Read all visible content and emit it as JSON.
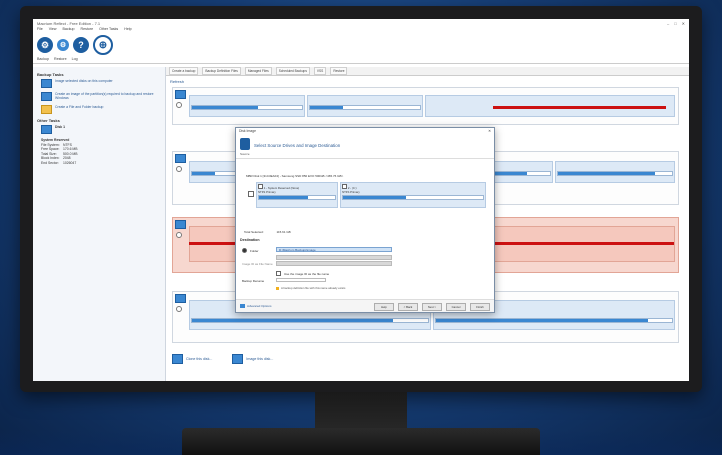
{
  "window": {
    "title": "Macrium Reflect - Free Edition - 7.1",
    "menu": [
      "File",
      "View",
      "Backup",
      "Restore",
      "Other Tasks",
      "Help"
    ],
    "ribbon_tabs": [
      "Backup",
      "Restore",
      "Log"
    ]
  },
  "left_panel": {
    "section_backup": "Backup Tasks",
    "tasks": [
      "Image selected disks on this computer",
      "Create an image of the partition(s) required to backup and restore Windows",
      "Create a File and Folder backup"
    ],
    "section_other": "Other Tasks",
    "section_disk": "Disk 1",
    "props_title": "System Reserved",
    "props": [
      {
        "k": "File System:",
        "v": "NTFS"
      },
      {
        "k": "Free Space:",
        "v": "170.6 MB"
      },
      {
        "k": "Total Size:",
        "v": "500.0 MB"
      },
      {
        "k": "Block Index:",
        "v": "2048"
      },
      {
        "k": "End Sector:",
        "v": "1026047"
      }
    ]
  },
  "content": {
    "tabs": [
      "Create a backup",
      "Backup Definition Files",
      "Managed Files",
      "Scheduled Backups",
      "VSS",
      "Restore"
    ],
    "refresh": "Refresh"
  },
  "bottom_links": [
    "Clone this disk...",
    "Image this disk..."
  ],
  "dialog": {
    "title": "Disk Image",
    "heading": "Select Source Drives and Image Destination",
    "source_label": "Source",
    "source_line": "MBR Disk 1 [31C3EAF2] - Samsung SSD 850 EVO 500GB <465.76 GB>",
    "source_parts": [
      {
        "label": "1 - System Reserved (None)",
        "fs": "NTFS Primary",
        "fill": 0.65
      },
      {
        "label": "2 - (C:)",
        "fs": "NTFS Primary",
        "fill": 0.45
      }
    ],
    "total_label": "Total Selected:",
    "total_value": "115.61 GB",
    "destination_label": "Destination",
    "folder_label": "Folder",
    "folder_value": "D:\\Macrium Backups\\image",
    "image_filename_label": "Image ID as File Name",
    "use_image_id_label": "Use the image ID as the file name",
    "backup_filename_label": "Backup filename",
    "warning": "A backup definition file with this name already exists",
    "advanced_label": "Advanced Options",
    "buttons": [
      "Help",
      "< Back",
      "Next >",
      "Cancel",
      "Finish"
    ]
  },
  "accent_blue": "#3a87d1",
  "accent_red": "#cc1111"
}
